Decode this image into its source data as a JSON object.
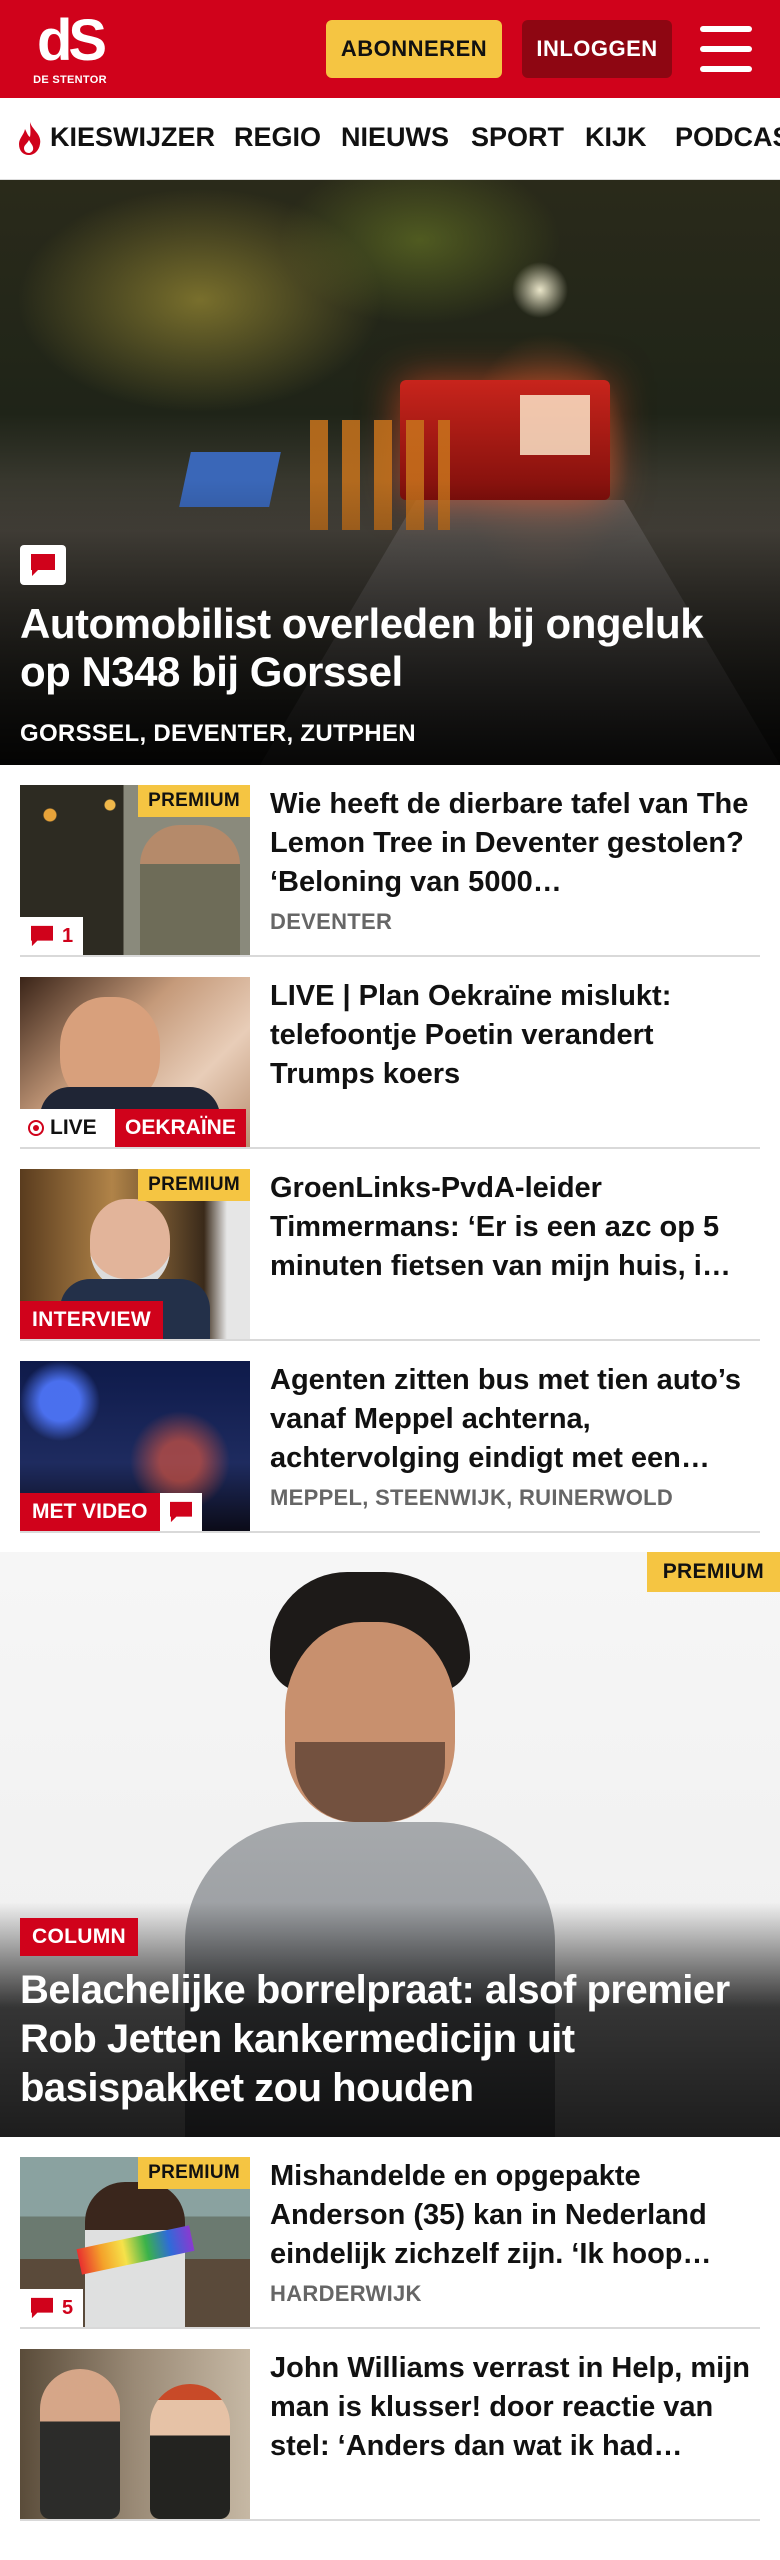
{
  "header": {
    "logo_mark": "dS",
    "logo_sub": "DE STENTOR",
    "subscribe_label": "ABONNEREN",
    "login_label": "INLOGGEN"
  },
  "nav": {
    "items": [
      "KIESWIJZER",
      "REGIO",
      "NIEUWS",
      "SPORT",
      "KIJK",
      "PODCAST"
    ]
  },
  "hero": {
    "title": "Automobilist overleden bij ongeluk op N348 bij Gorssel",
    "tags": "GORSSEL, DEVENTER, ZUTPHEN"
  },
  "articles": [
    {
      "title": "Wie heeft de dierbare tafel van The Lemon Tree in Deventer gestolen? ‘Beloning van 5000…",
      "tags": "DEVENTER",
      "premium": "PREMIUM",
      "comments": "1"
    },
    {
      "title": "LIVE | Plan Oekraïne mislukt: telefoontje Poetin verandert Trumps koers",
      "live_label": "LIVE",
      "topic": "OEKRAÏNE"
    },
    {
      "title": "GroenLinks-PvdA-leider Timmermans: ‘Er is een azc op 5 minuten fietsen van mijn huis, i…",
      "premium": "PREMIUM",
      "label": "INTERVIEW"
    },
    {
      "title": "Agenten zitten bus met tien auto’s vanaf Meppel achterna, achtervolging eindigt met een…",
      "tags": "MEPPEL, STEENWIJK, RUINERWOLD",
      "label": "MET VIDEO"
    }
  ],
  "column": {
    "premium": "PREMIUM",
    "label": "COLUMN",
    "title": "Belachelijke borrelpraat: alsof premier Rob Jetten kankermedicijn uit basispakket zou houden"
  },
  "articles_2": [
    {
      "title": "Mishandelde en opgepakte Anderson (35) kan in Nederland eindelijk zichzelf zijn. ‘Ik hoop…",
      "tags": "HARDERWIJK",
      "premium": "PREMIUM",
      "comments": "5"
    },
    {
      "title": "John Williams verrast in Help, mijn man is klusser! door reactie van stel: ‘Anders dan wat ik had…"
    }
  ],
  "colors": {
    "brand_red": "#d0021b",
    "login_dark_red": "#8e0612",
    "premium_yellow": "#f5c542"
  }
}
